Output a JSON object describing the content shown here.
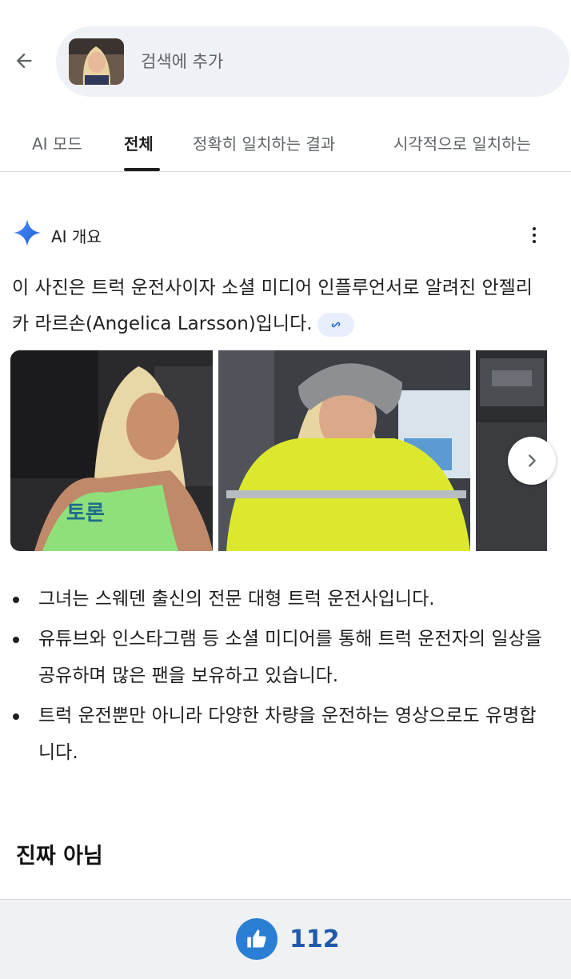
{
  "search": {
    "placeholder": "검색에 추가",
    "back_icon": "arrow-left-icon"
  },
  "tabs": [
    {
      "label": "AI 모드",
      "active": false
    },
    {
      "label": "전체",
      "active": true
    },
    {
      "label": "정확히 일치하는 결과",
      "active": false
    },
    {
      "label": "시각적으로 일치하는",
      "active": false
    }
  ],
  "ai_overview": {
    "title": "AI 개요",
    "summary": "이 사진은 트럭 운전사이자 소셜 미디어 인플루언서로 알려진 안젤리카 라르손(Angelica Larsson)입니다.",
    "bullets": [
      "그녀는 스웨덴 출신의 전문 대형 트럭 운전사입니다.",
      "유튜브와 인스타그램 등 소셜 미디어를 통해 트럭 운전자의 일상을 공유하며 많은 팬을 보유하고 있습니다.",
      "트럭 운전뿐만 아니라 다양한 차량을 운전하는 영상으로도 유명합니다."
    ]
  },
  "caption": "진짜 아님",
  "footer": {
    "like_count": "112"
  },
  "colors": {
    "accent_blue": "#2a7fd4",
    "like_count": "#1e5aa8",
    "search_bg": "#eef1f6",
    "chip_bg": "#e8eefc"
  }
}
